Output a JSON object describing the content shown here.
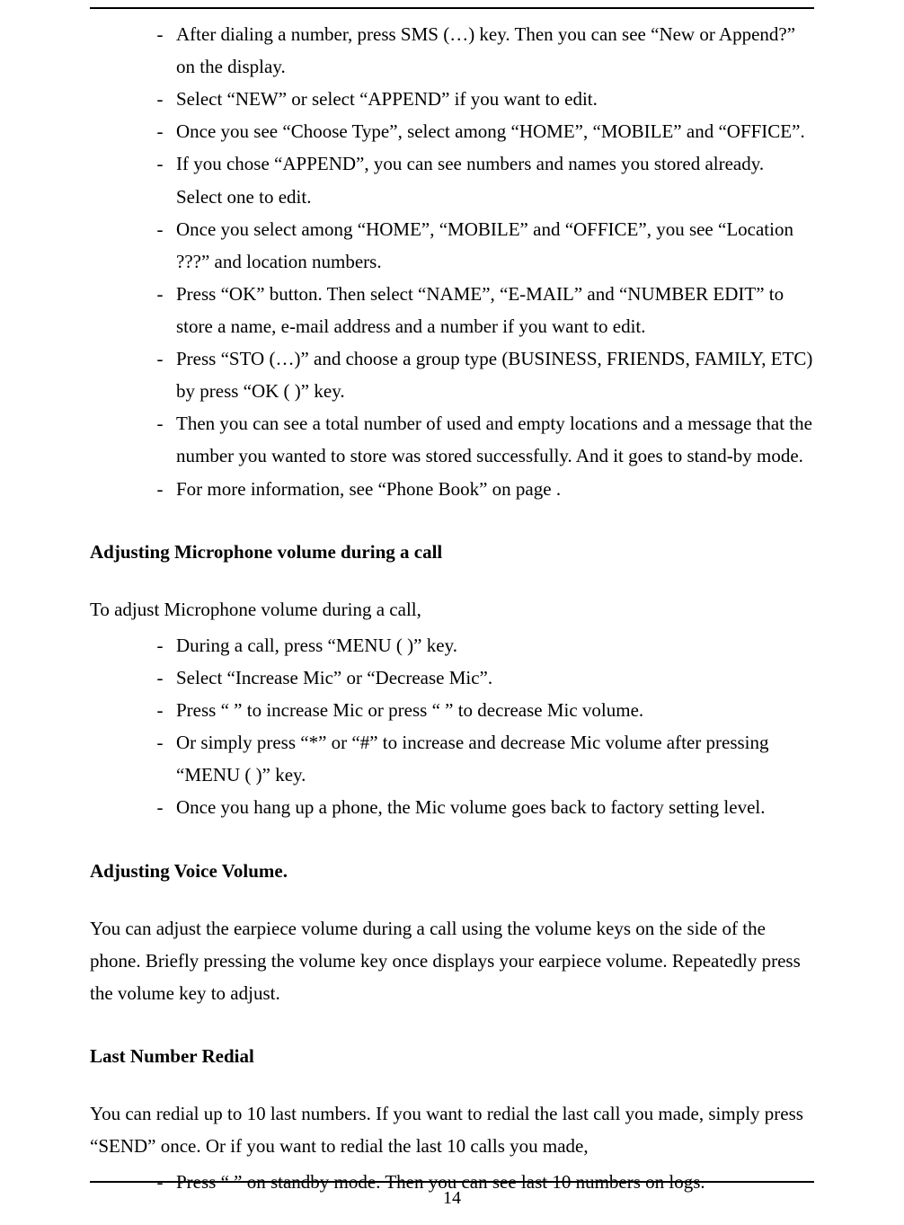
{
  "page_number": "14",
  "dash": "-",
  "section1_items": [
    "After dialing a number, press SMS (…) key. Then you can see “New or Append?” on the display.",
    "Select “NEW” or select “APPEND” if you want to edit.",
    "Once you see “Choose Type”, select among “HOME”, “MOBILE” and “OFFICE”.",
    "If you chose “APPEND”, you can see numbers and names you stored already. Select one to edit.",
    "Once you select among “HOME”, “MOBILE” and “OFFICE”, you see “Location ???” and location numbers.",
    "Press “OK” button. Then select “NAME”, “E-MAIL” and “NUMBER EDIT” to store a name, e-mail address and a number if you want to edit.",
    "Press “STO (…)” and choose a group type (BUSINESS, FRIENDS, FAMILY, ETC) by press “OK (   )” key.",
    "Then you can see a total number of used and empty locations and a message that the number you wanted to store was stored successfully. And it goes to stand-by mode.",
    "For more information, see “Phone Book” on  page    ."
  ],
  "heading_mic": "Adjusting Microphone volume during a call",
  "mic_intro": "To adjust Microphone volume during a call,",
  "mic_items": [
    "During a call, press “MENU (   )” key.",
    "Select “Increase Mic” or “Decrease Mic”.",
    "Press “   ” to increase Mic or press “   ” to decrease Mic volume.",
    "Or simply press “*” or “#” to increase and decrease Mic volume after pressing “MENU (   )” key.",
    "Once you hang up a phone, the Mic volume goes back to factory setting level."
  ],
  "heading_voice": "Adjusting Voice Volume.",
  "voice_para": "You can adjust the earpiece volume during a call using the volume keys on the side of the phone. Briefly pressing the volume key once displays your earpiece volume. Repeatedly press the volume key to adjust.",
  "heading_redial": "Last Number Redial",
  "redial_para": "You can redial up to 10 last numbers. If you want to redial the last call you made, simply press “SEND” once. Or if you want to redial the last 10 calls you made,",
  "redial_items": [
    "Press “   ” on standby mode. Then you can see last 10 numbers on logs."
  ]
}
